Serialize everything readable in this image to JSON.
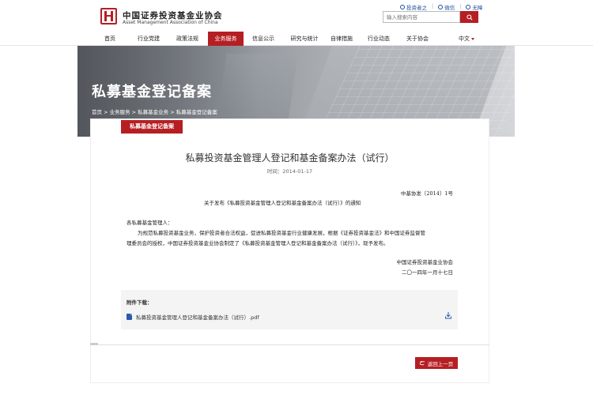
{
  "header": {
    "logo_cn": "中国证券投资基金业协会",
    "logo_en": "Asset Management Association of China",
    "toplinks": [
      {
        "label": "投资者之",
        "icon": "user-icon"
      },
      {
        "label": "微信",
        "icon": "wechat-icon"
      },
      {
        "label": "无障",
        "icon": "accessibility-icon"
      }
    ],
    "search_placeholder": "输入搜索内容"
  },
  "nav": {
    "items": [
      {
        "label": "首页"
      },
      {
        "label": "行业党建"
      },
      {
        "label": "政策法规"
      },
      {
        "label": "业务服务",
        "active": true
      },
      {
        "label": "信息公示"
      },
      {
        "label": "研究与统计"
      },
      {
        "label": "自律措施"
      },
      {
        "label": "行业动态"
      },
      {
        "label": "关于协会"
      }
    ],
    "language": "中文"
  },
  "banner": {
    "title": "私募基金登记备案",
    "breadcrumb": "首页 > 业务服务 > 私募基金业务 > 私募基金登记备案"
  },
  "content": {
    "tag": "私募基金登记备案",
    "title": "私募投资基金管理人登记和基金备案办法（试行）",
    "time": "时间：2014-01-17",
    "doc_number": "中基协发〔2014〕1号",
    "notice_title": "关于发布《私募投资基金管理人登记和基金备案办法（试行）》的通知",
    "greeting": "各私募基金管理人：",
    "paragraph_line1": "为规范私募投资基金业务，保护投资者合法权益，促进私募投资基金行业健康发展，根据《证券投资基金法》和中国证券监督管",
    "paragraph_line2": "理委员会的授权，中国证券投资基金业协会制定了《私募投资基金管理人登记和基金备案办法（试行）》，现予发布。",
    "signer": "中国证券投资基金业协会",
    "sign_date": "二〇一四年一月十七日",
    "attachment_label": "附件下载：",
    "attachment_file": "私募投资基金管理人登记和基金备案办法（试行）.pdf",
    "back_button": "返回上一页"
  },
  "colors": {
    "brand_red": "#b51f23",
    "link_blue": "#1a4fa0"
  }
}
